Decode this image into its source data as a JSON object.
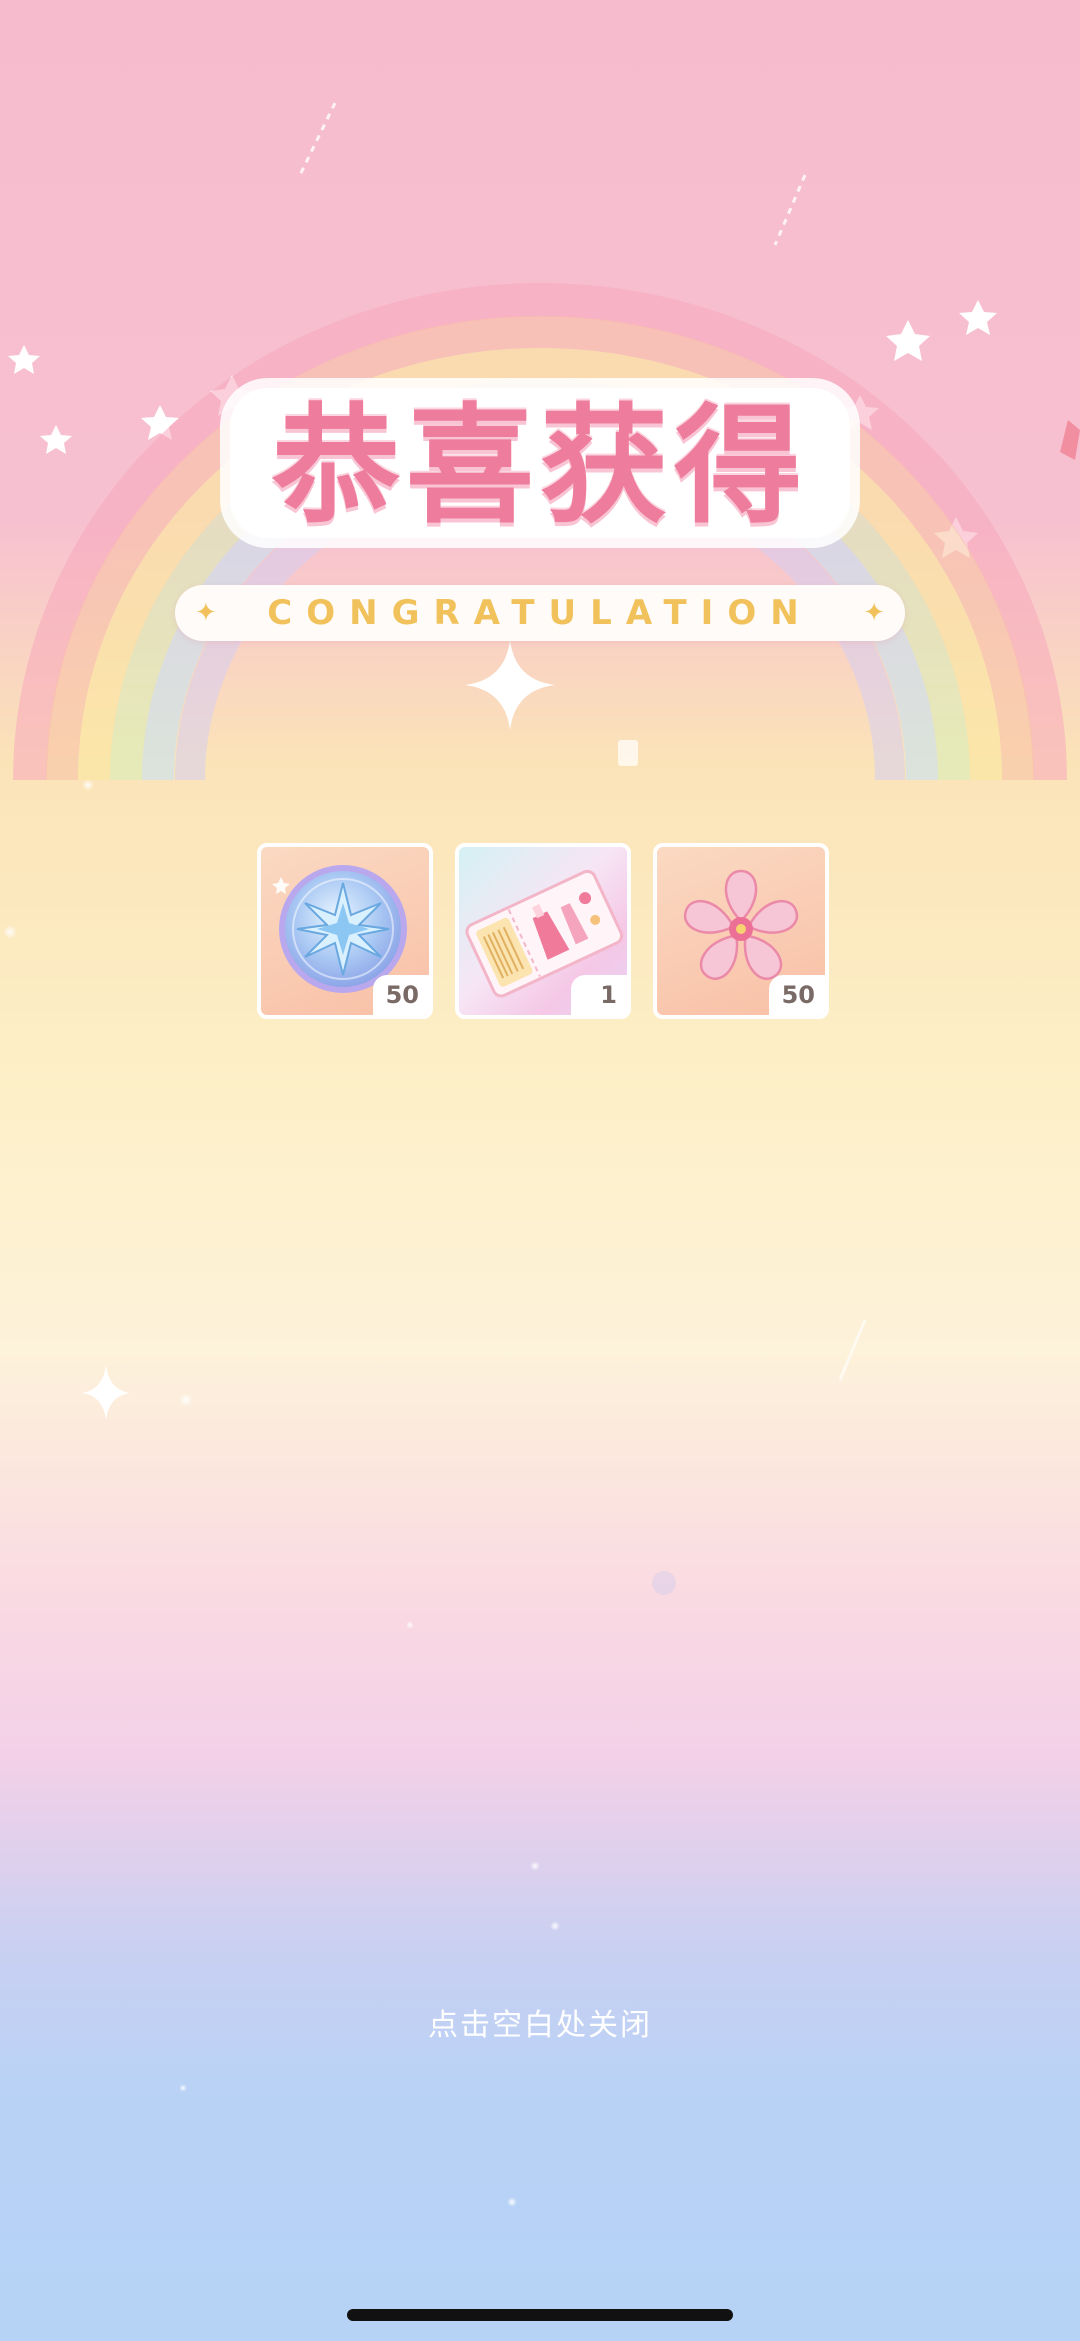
{
  "title": {
    "main": "恭喜获得",
    "subtitle": "CONGRATULATION"
  },
  "rewards": [
    {
      "icon": "star-coin-icon",
      "count": "50"
    },
    {
      "icon": "ticket-icon",
      "count": "1"
    },
    {
      "icon": "sakura-icon",
      "count": "50"
    }
  ],
  "close_hint": "点击空白处关闭",
  "colors": {
    "title_pink": "#ee7c9c",
    "subtitle_gold": "#f1c25b",
    "bg_top": "#f6bccd",
    "bg_bottom": "#b6d3f6"
  }
}
